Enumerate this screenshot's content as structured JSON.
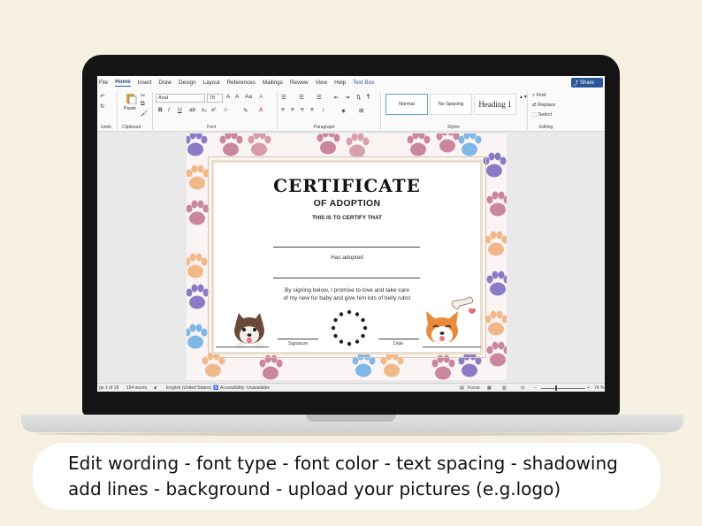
{
  "ribbon_tabs": [
    "File",
    "Home",
    "Insert",
    "Draw",
    "Design",
    "Layout",
    "References",
    "Mailings",
    "Review",
    "View",
    "Help",
    "Text Box"
  ],
  "active_tab": "Home",
  "share_label": "Share",
  "clipboard": {
    "paste": "Paste",
    "group": "Clipboard"
  },
  "undo_group": "Undo",
  "font": {
    "name": "Arial",
    "size": "78",
    "group": "Font"
  },
  "paragraph_group": "Paragraph",
  "styles": {
    "items": [
      "Normal",
      "No Spacing",
      "Heading 1"
    ],
    "group": "Styles"
  },
  "editing": {
    "find": "Find",
    "replace": "Replace",
    "select": "Select",
    "group": "Editing"
  },
  "certificate": {
    "title": "CERTIFICATE",
    "subtitle": "OF ADOPTION",
    "certify": "THIS IS TO CERTIFY THAT",
    "adopted": "Has adopted",
    "promise_1": "By signing below, I promise to love and take care",
    "promise_2": "of my new fur baby and give him lots of belly rubs!",
    "signature_label": "Signature",
    "date_label": "Date"
  },
  "status": {
    "page": "ge 1 of 18",
    "words": "154 words",
    "language": "English (United States)",
    "accessibility": "Accessibility: Unavailable",
    "focus": "Focus",
    "zoom": "74 %"
  },
  "caption": {
    "line1": "Edit wording - font type - font color - text spacing - shadowing",
    "line2": "add lines - background -  upload your pictures (e.g.logo)"
  },
  "colors": {
    "background": "#f5f0e1",
    "accent_blue": "#2b579a",
    "paw_pink": "#c9869c",
    "paw_purple": "#8a7cc4",
    "paw_orange": "#f1b98a",
    "paw_blue": "#7fb8e6"
  }
}
